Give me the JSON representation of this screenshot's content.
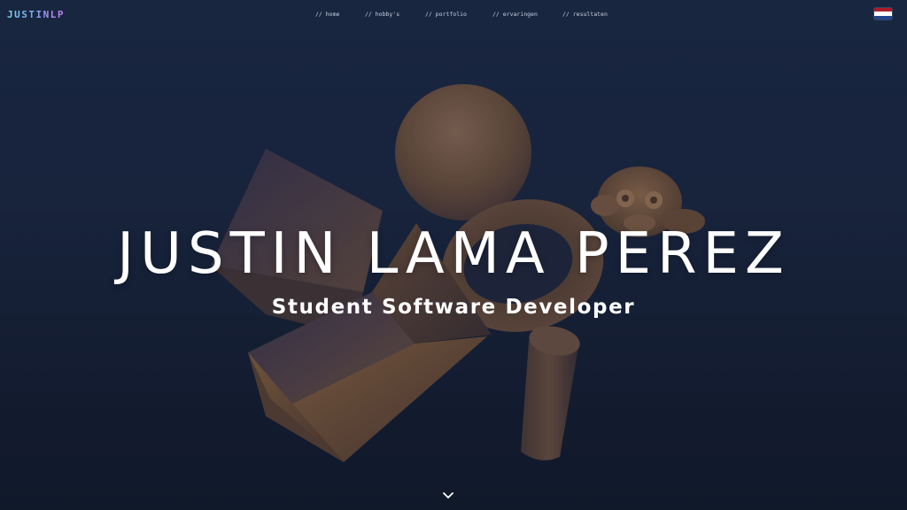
{
  "header": {
    "logo": "JUSTINLP",
    "nav": [
      {
        "label": "// home"
      },
      {
        "label": "// hobby's"
      },
      {
        "label": "// portfolio"
      },
      {
        "label": "// ervaringen"
      },
      {
        "label": "// resultaten"
      }
    ],
    "language_flag": {
      "icon": "dutch-flag-icon",
      "colors": [
        "#ae1c28",
        "#ffffff",
        "#21468b"
      ]
    }
  },
  "hero": {
    "title": "JUSTIN LAMA PEREZ",
    "subtitle": "Student Software Developer",
    "scroll_icon": "chevron-down-icon"
  },
  "colors": {
    "background_top": "#1b2a45",
    "background_bottom": "#111a2a",
    "object_bronze": "#7a5a3c",
    "logo_gradient": [
      "#7ad7f0",
      "#c77af0"
    ]
  }
}
